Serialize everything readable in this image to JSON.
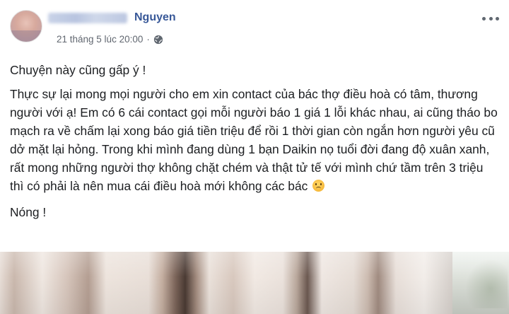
{
  "post": {
    "author_name": "Nguyen",
    "timestamp": "21 tháng 5 lúc 20:00",
    "separator": "·",
    "privacy_icon": "globe-icon",
    "more_icon": "ellipsis-icon",
    "paragraphs": [
      "Chuyện này cũng gấp ý !",
      "Thực sự lại mong mọi người cho em xin contact của bác thợ điều hoà có tâm, thương người với ạ! Em có 6 cái contact gọi mỗi người báo 1 giá 1 lỗi khác nhau, ai cũng tháo bo mạch ra về chấm lại xong báo giá tiền triệu để rồi 1 thời gian còn ngắn hơn người yêu cũ dở mặt lại hỏng. Trong khi mình đang dùng 1 bạn Daikin nọ tuổi đời đang độ xuân xanh, rất mong những người thợ không chặt chém và thật tử tế với mình chứ tầm trên 3 triệu thì có phải là nên mua cái điều hoà mới không các bác",
      "Nóng !"
    ],
    "emoji": "sad-face-emoji",
    "photo": "curtain-photo"
  },
  "colors": {
    "author": "#385898",
    "meta": "#616770",
    "text": "#1c1e21",
    "background": "#ffffff"
  }
}
